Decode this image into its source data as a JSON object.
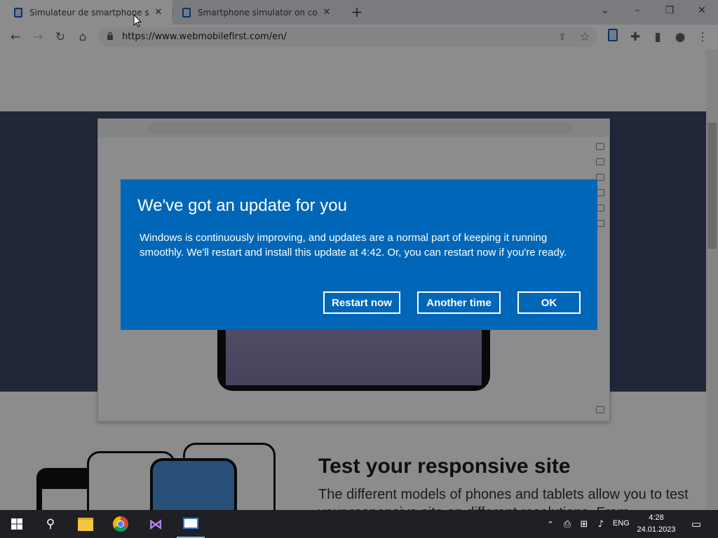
{
  "browser": {
    "tabs": [
      {
        "label": "Simulateur de smartphone sur c"
      },
      {
        "label": "Smartphone simulator on compu"
      }
    ],
    "url": "https://www.webmobilefirst.com/en/"
  },
  "page": {
    "heading": "Test your responsive site",
    "subtext": "The different models of phones and tablets allow you to test your responsive site on different resolutions. From"
  },
  "dialog": {
    "title": "We've got an update for you",
    "body": "Windows is continuously improving, and updates are a normal part of keeping it running smoothly. We'll restart and install this update at 4:42. Or, you can restart now if you're ready.",
    "buttons": {
      "restart": "Restart now",
      "another": "Another time",
      "ok": "OK"
    },
    "color": "#0067b8"
  },
  "taskbar": {
    "lang": "ENG",
    "time": "4:28",
    "date": "24.01.2023"
  }
}
